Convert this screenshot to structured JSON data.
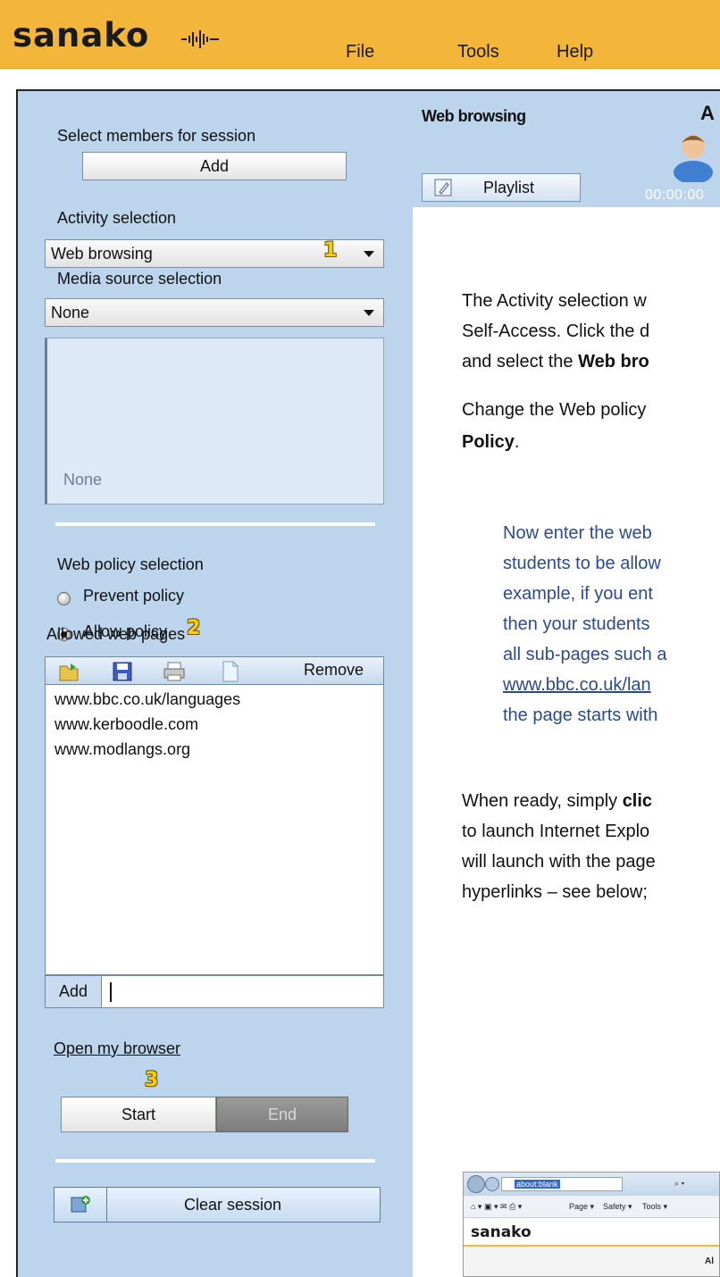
{
  "app": {
    "logo": "sanako",
    "menu": [
      "File",
      "Tools",
      "Help"
    ]
  },
  "left": {
    "select_members_label": "Select members for session",
    "add_button": "Add",
    "activity_label": "Activity selection",
    "activity_value": "Web browsing",
    "badge_1": "1",
    "media_label": "Media source selection",
    "media_value": "None",
    "media_box_text": "None",
    "web_policy_label": "Web policy selection",
    "prevent_policy": "Prevent policy",
    "allow_policy": "Allow policy",
    "allow_policy_selected": true,
    "badge_2": "2",
    "allowed_pages_label": "Allowed web pages",
    "remove_button": "Remove",
    "allowed_pages": [
      "www.bbc.co.uk/languages",
      "www.kerboodle.com",
      "www.modlangs.org"
    ],
    "add_page_button": "Add",
    "open_browser_link": "Open my browser",
    "badge_3": "3",
    "start_button": "Start",
    "end_button": "End",
    "clear_session_button": "Clear session"
  },
  "right": {
    "section_title": "Web browsing",
    "corner_letter": "A",
    "playlist_button": "Playlist",
    "timer": "00:00:00",
    "para1": [
      "The Activity selection w",
      "Self-Access.  Click the d",
      "and select the "
    ],
    "para1_bold": "Web bro",
    "para2": [
      "Change the Web policy"
    ],
    "para2_bold": "Policy",
    "para2_end": ".",
    "para3": [
      "Now enter the web",
      "students to be allow",
      "example, if you ent",
      "then your students",
      "all sub-pages such a"
    ],
    "para3_link": "www.bbc.co.uk/lan",
    "para3_end": "the page starts with",
    "para4_start": "When ready, simply ",
    "para4_bold": "clic",
    "para4": [
      "to launch Internet Explo",
      "will launch with the page",
      "hyperlinks – see below;"
    ],
    "screenshot": {
      "address": "about:blank",
      "toolbar_items": [
        "Page ▾",
        "Safety ▾",
        "Tools ▾"
      ],
      "logo": "sanako",
      "corner_text": "Al"
    }
  }
}
